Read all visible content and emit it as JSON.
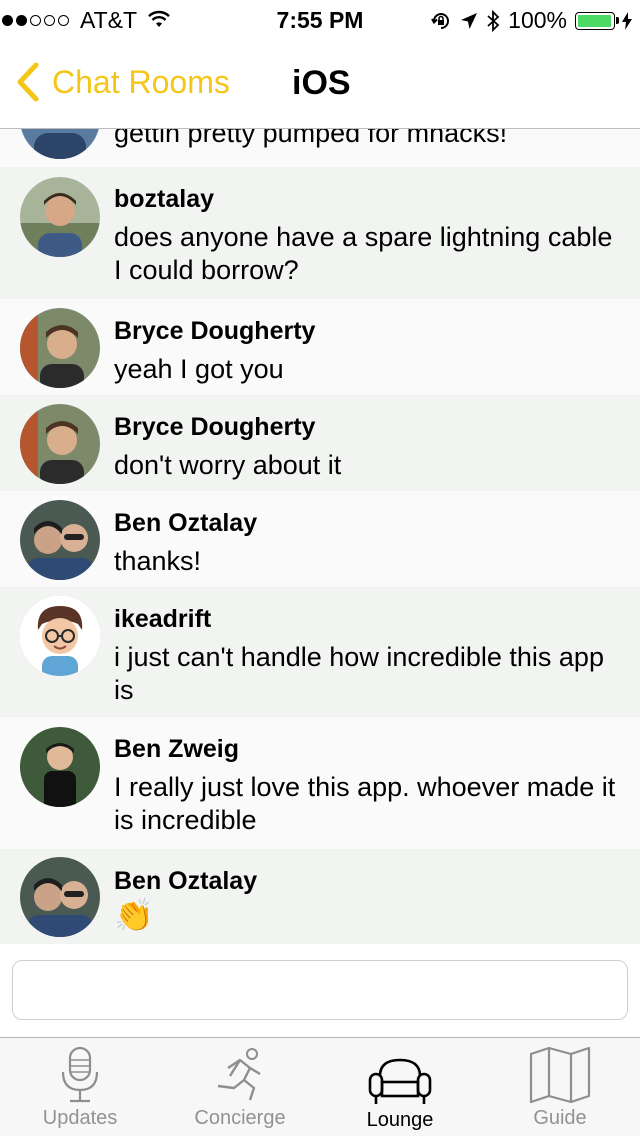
{
  "status_bar": {
    "carrier": "AT&T",
    "time": "7:55 PM",
    "battery": "100%",
    "battery_level": 1.0,
    "signal_bars_filled": 2,
    "signal_bars_total": 5
  },
  "nav": {
    "back_label": "Chat Rooms",
    "title": "iOS"
  },
  "messages": [
    {
      "name": "",
      "text": "gettin pretty pumped for mhacks!"
    },
    {
      "name": "boztalay",
      "text": "does anyone have a spare lightning cable I could borrow?"
    },
    {
      "name": "Bryce Dougherty",
      "text": "yeah I got you"
    },
    {
      "name": "Bryce Dougherty",
      "text": "don't worry about it"
    },
    {
      "name": "Ben Oztalay",
      "text": "thanks!"
    },
    {
      "name": "ikeadrift",
      "text": "i just can't handle how incredible this app is"
    },
    {
      "name": "Ben Zweig",
      "text": "I really just love this app. whoever made it is incredible"
    },
    {
      "name": "Ben Oztalay",
      "text": "👏"
    }
  ],
  "input": {
    "value": "",
    "placeholder": ""
  },
  "tabs": [
    {
      "label": "Updates",
      "icon": "microphone-icon",
      "active": false
    },
    {
      "label": "Concierge",
      "icon": "running-person-icon",
      "active": false
    },
    {
      "label": "Lounge",
      "icon": "couch-icon",
      "active": true
    },
    {
      "label": "Guide",
      "icon": "map-icon",
      "active": false
    }
  ],
  "colors": {
    "accent": "#f5c618",
    "battery_green": "#4cd964",
    "row_alt": "#f2f4f2",
    "row_plain": "#fafafa",
    "tab_inactive": "#929292"
  }
}
